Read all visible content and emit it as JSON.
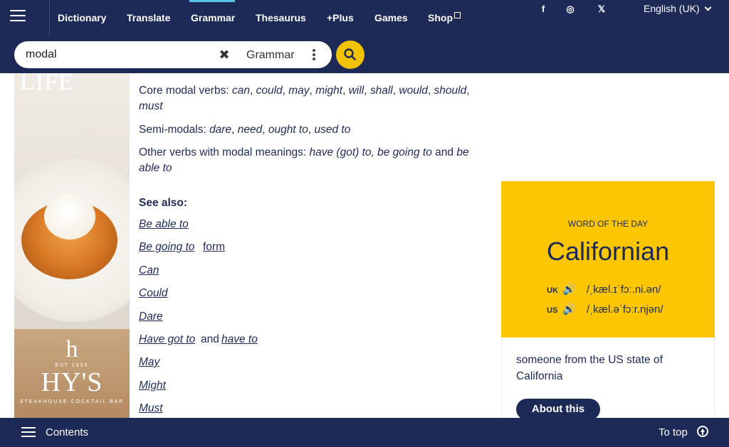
{
  "topnav": {
    "items": [
      "Dictionary",
      "Translate",
      "Grammar",
      "Thesaurus",
      "+Plus",
      "Games",
      "Shop"
    ],
    "social": [
      "f",
      "◎",
      "𝕏"
    ],
    "language": "English (UK)"
  },
  "search": {
    "value": "modal",
    "clear_icon": "✖",
    "scope": "Grammar"
  },
  "advert": {
    "top_word": "LIFE",
    "brand_mark": "h",
    "established": "EST 1955",
    "brand_name": "HY'S",
    "subtitle": "STEAKHOUSE COCKTAIL BAR"
  },
  "content": {
    "core": {
      "label": "Core modal verbs:",
      "verbs": [
        "can",
        "could",
        "may",
        "might",
        "will",
        "shall",
        "would",
        "should",
        "must"
      ]
    },
    "semi": {
      "label": "Semi-modals:",
      "verbs": [
        "dare",
        "need",
        "ought to",
        "used to"
      ]
    },
    "other": {
      "label": "Other verbs with modal meanings:",
      "part1": "have (got) to, be going to",
      "and_text": "and",
      "part2": "be able to"
    },
    "see_also": "See also:",
    "links": {
      "be_able_to": "Be able to",
      "be_going_to": "Be going to",
      "form": "form",
      "can": "Can",
      "could": "Could",
      "dare": "Dare",
      "have_got_to": "Have got to",
      "and_text": "and",
      "have_to": "have to",
      "may": "May",
      "might": "Might",
      "must": "Must"
    }
  },
  "share": {
    "facebook": "f",
    "x": "𝕏"
  },
  "word_of_the_day": {
    "label": "WORD OF THE DAY",
    "word": "Californian",
    "uk_label": "UK",
    "uk_ipa": "/ˌkæl.ɪˈfɔː.ni.ən/",
    "us_label": "US",
    "us_ipa": "/ˌkæl.əˈfɔːr.njən/",
    "speaker_icon": "🔊",
    "definition": "someone from the US state of California",
    "about_button": "About this"
  },
  "bottombar": {
    "contents": "Contents",
    "to_top": "To top"
  }
}
